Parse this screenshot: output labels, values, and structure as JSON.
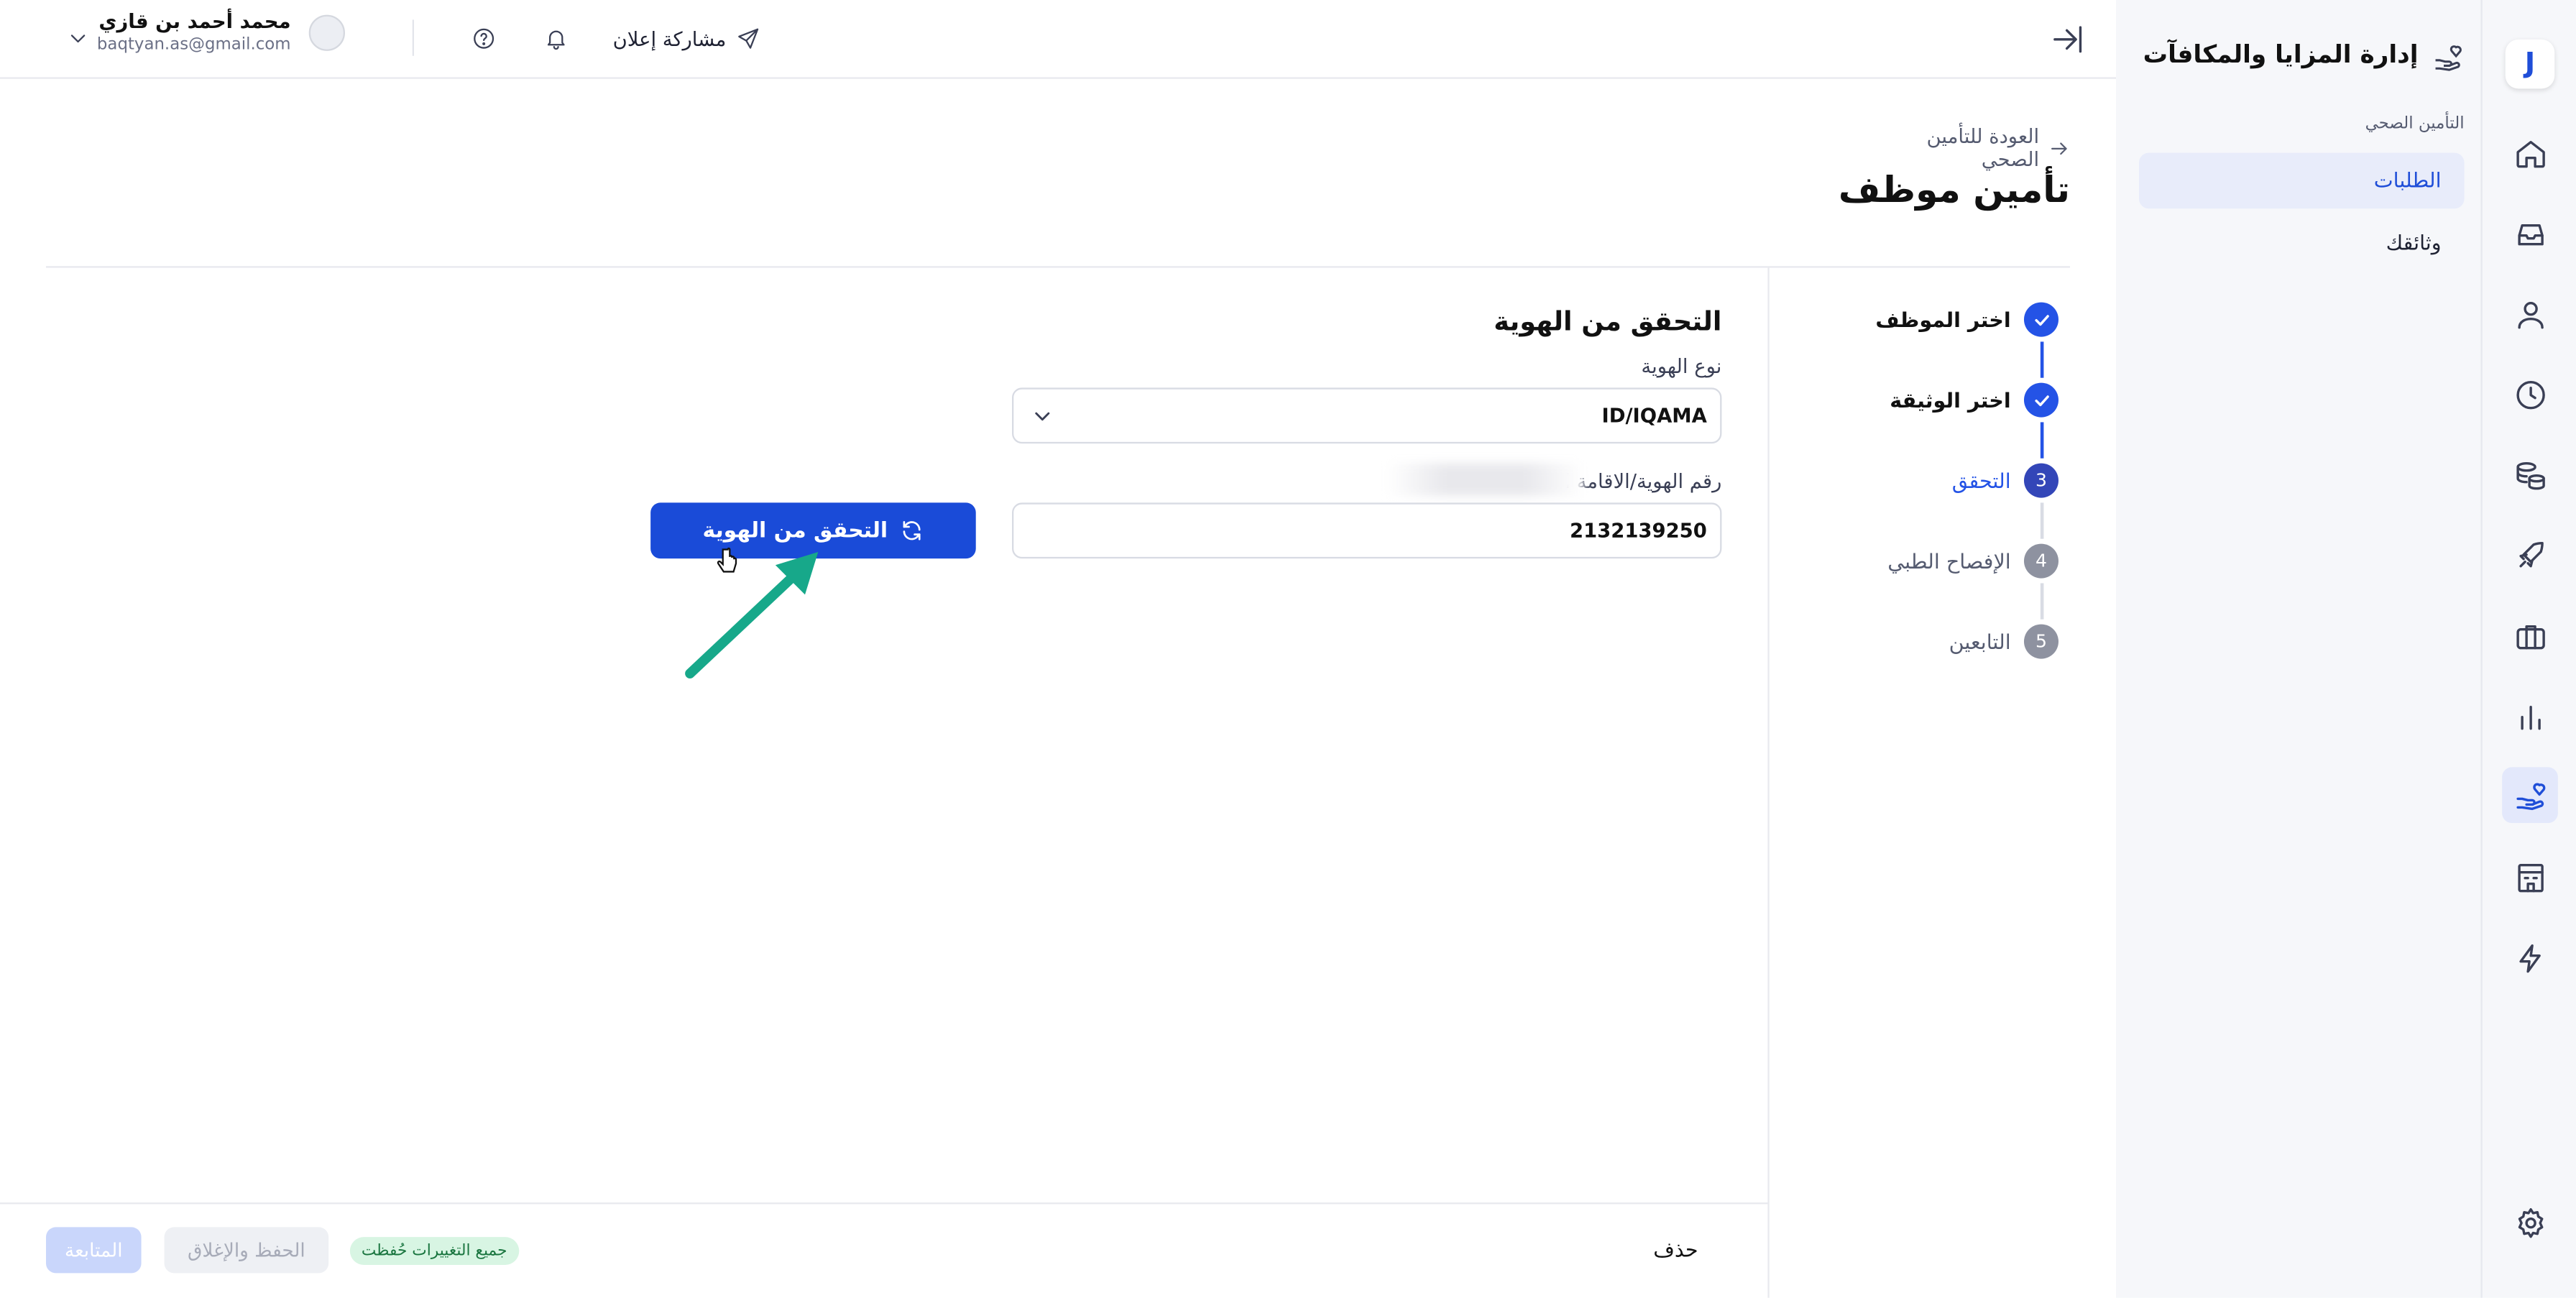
{
  "sidebar": {
    "logo_letter": "J",
    "icons": [
      "home-icon",
      "inbox-icon",
      "user-icon",
      "clock-icon",
      "coins-icon",
      "rocket-icon",
      "briefcase-icon",
      "bar-chart-icon",
      "hand-heart-icon",
      "building-icon",
      "lightning-icon",
      "settings-icon"
    ],
    "active_icon": "hand-heart-icon"
  },
  "subnav": {
    "title": "إدارة المزايا والمكافآت",
    "section": "التأمين الصحي",
    "items": [
      {
        "label": "الطلبات",
        "active": true
      },
      {
        "label": "وثائقك",
        "active": false
      }
    ]
  },
  "topbar": {
    "user_name": "محمد أحمد بن قازي",
    "user_email": "baqtyan.as@gmail.com",
    "share_label": "مشاركة إعلان"
  },
  "main": {
    "back_label": "العودة للتأمين الصحي",
    "title": "تأمين موظف"
  },
  "stepper": [
    {
      "label": "اختر الموظف",
      "state": "done",
      "num": ""
    },
    {
      "label": "اختر الوثيقة",
      "state": "done",
      "num": ""
    },
    {
      "label": "التحقق",
      "state": "current",
      "num": "3"
    },
    {
      "label": "الإفصاح الطبي",
      "state": "todo",
      "num": "4"
    },
    {
      "label": "التابعين",
      "state": "todo",
      "num": "5"
    }
  ],
  "form": {
    "title": "التحقق من الهوية",
    "id_type_label": "نوع الهوية",
    "id_type_value": "ID/IQAMA",
    "id_number_label": "رقم الهوية/الاقامة ا",
    "id_number_value": "2132139250",
    "verify_button": "التحقق من الهوية"
  },
  "footer": {
    "delete_label": "حذف",
    "saved_badge": "جميع التغييرات حُفظت",
    "save_close_label": "الحفظ والإغلاق",
    "next_label": "المتابعة"
  },
  "colors": {
    "primary": "#1a4bd8",
    "annotation_arrow": "#17a88a",
    "saved_badge_bg": "#d8f5e3"
  }
}
